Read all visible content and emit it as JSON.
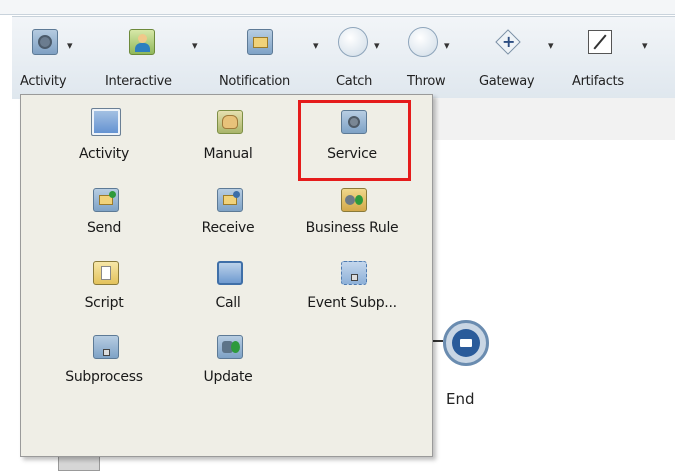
{
  "toolbar": {
    "items": [
      {
        "label": "Activity",
        "icon": "gear-box-icon"
      },
      {
        "label": "Interactive",
        "icon": "person-icon"
      },
      {
        "label": "Notification",
        "icon": "envelope-icon"
      },
      {
        "label": "Catch",
        "icon": "circle-event-icon"
      },
      {
        "label": "Throw",
        "icon": "circle-event-icon"
      },
      {
        "label": "Gateway",
        "icon": "gateway-diamond-icon"
      },
      {
        "label": "Artifacts",
        "icon": "annotation-icon"
      }
    ],
    "caret": "▾"
  },
  "menu": {
    "items": [
      {
        "label": "Activity",
        "icon": "activity-icon"
      },
      {
        "label": "Manual",
        "icon": "manual-task-icon"
      },
      {
        "label": "Service",
        "icon": "service-gear-icon",
        "selected": true
      },
      {
        "label": "Send",
        "icon": "send-envelope-icon"
      },
      {
        "label": "Receive",
        "icon": "receive-envelope-icon"
      },
      {
        "label": "Business Rule",
        "icon": "business-rule-icon"
      },
      {
        "label": "Script",
        "icon": "script-icon"
      },
      {
        "label": "Call",
        "icon": "call-activity-icon"
      },
      {
        "label": "Event Subp...",
        "icon": "event-subprocess-icon"
      },
      {
        "label": "Subprocess",
        "icon": "subprocess-icon"
      },
      {
        "label": "Update",
        "icon": "update-task-icon"
      }
    ]
  },
  "canvas": {
    "end_label": "End"
  },
  "colors": {
    "selection": "#e51b1b",
    "menu_bg": "#efeee6",
    "end_event": "#2a5b9a"
  }
}
